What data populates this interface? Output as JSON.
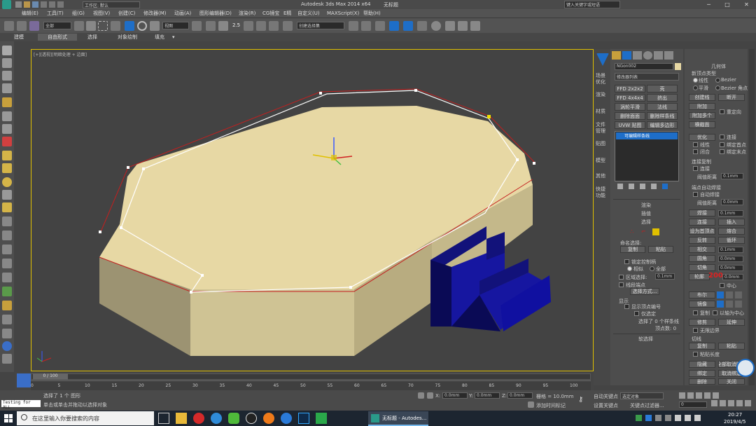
{
  "title_bar": {
    "workspace": "工作区: 默认",
    "app_title": "Autodesk 3ds Max  2014 x64",
    "file_name": "无标题",
    "search_placeholder": "键入关键字或短语"
  },
  "menu": [
    "编辑(E)",
    "工具(T)",
    "组(G)",
    "视图(V)",
    "创建(C)",
    "修改器(M)",
    "动画(A)",
    "图形编辑器(D)",
    "渲染(R)",
    "CG镜宝",
    "E精",
    "自定义(U)",
    "MAXScript(X)",
    "帮助(H)"
  ],
  "toolbar": {
    "filter": "全部",
    "coord": "视图",
    "snap_angle": "2.5",
    "selection_set": "创建选择集"
  },
  "ribbon_tabs": [
    "建模",
    "自由形式",
    "选择",
    "对象绘制",
    "填充"
  ],
  "viewport": {
    "label": "[+][透视][明暗处理 + 边面]"
  },
  "command_panel_left": [
    "场景优化",
    "渲染",
    "材质",
    "文件管理",
    "贴图",
    "模型",
    "其他",
    "快捷功能"
  ],
  "modifier_panel": {
    "object_name": "NGon002",
    "modifier_list": "修改器列表",
    "buttons": [
      "FFD 2x2x2",
      "壳",
      "FFD 4x4x4",
      "挤出",
      "涡轮平滑",
      "法线",
      "删除面面",
      "删除样条线",
      "UVW 贴图",
      "编辑多边形"
    ],
    "stack_item": "可编辑样条线",
    "rollouts": [
      "渲染",
      "插值",
      "选择"
    ],
    "named_selection": "命名选择:",
    "copy": "复制",
    "paste": "粘贴",
    "lock_handles": "锁定控制柄",
    "similar": "相似",
    "all": "全部",
    "area_selection": "区域选择:",
    "area_value": "0.1mm",
    "segment_end": "线段端点",
    "select_by": "选择方式...",
    "display": "显示",
    "show_vertex_numbers": "显示顶点编号",
    "selected_only": "仅选定",
    "selected_info": "选择了 0 个样条线",
    "vertex_count": "顶点数: 0",
    "soft_selection": "软选择"
  },
  "geometry_panel": {
    "title": "几何体",
    "new_vertex_type": "新顶点类型",
    "linear": "线性",
    "bezier": "Bezier",
    "smooth": "平滑",
    "bezier_corner": "Bezier 角点",
    "create_line": "创建线",
    "break": "断开",
    "attach": "附加",
    "attach_multiple": "附加多个",
    "reorient": "重定向",
    "cross_section": "横截面",
    "optimize": "优化",
    "connect": "连接",
    "linear2": "线性",
    "bind_first": "绑定首点",
    "closed": "闭合",
    "bind_last": "绑定末点",
    "connect_copy": "连接复制",
    "connect_chk": "连接",
    "threshold": "阈值距离",
    "threshold_value": "0.1mm",
    "end_point_auto_weld": "端点自动焊接",
    "auto_weld": "自动焊接",
    "threshold2": "阈值距离",
    "threshold2_value": "0.0mm",
    "weld": "焊接",
    "weld_value": "0.1mm",
    "connect_btn": "连接",
    "insert": "插入",
    "make_first": "设为首顶点",
    "fuse": "熔合",
    "reverse": "反转",
    "cycle": "循环",
    "crossinsert": "相交",
    "crossinsert_value": "0.1mm",
    "fillet": "圆角",
    "fillet_value": "0.0mm",
    "chamfer": "切角",
    "chamfer_value": "0.0mm",
    "outline": "轮廓",
    "outline_value": "200",
    "outline_unit": "0.0mm",
    "center": "中心",
    "boolean": "布尔",
    "mirror": "镜像",
    "copy_chk": "复制",
    "about_pivot": "以轴为中心",
    "trim": "修剪",
    "extend": "延伸",
    "infinite_bounds": "无限边界",
    "tangent": "切线",
    "copy_btn": "复制",
    "paste_btn": "粘贴",
    "paste_length": "粘贴长度",
    "hide": "隐藏",
    "unhide_all": "全部取消隐藏",
    "bind": "绑定",
    "unbind": "取消绑定",
    "delete": "删除",
    "close": "关闭"
  },
  "timeline": {
    "frame": "0 / 100",
    "ticks": [
      "0",
      "5",
      "10",
      "15",
      "20",
      "25",
      "30",
      "35",
      "40",
      "45",
      "50",
      "55",
      "60",
      "65",
      "70",
      "75",
      "80",
      "85",
      "90",
      "95",
      "100"
    ]
  },
  "status": {
    "maxscript_label": "Testing for ALL",
    "selected": "选择了 1 个 图形",
    "prompt": "单击或单击并拖动以选择对象",
    "x_label": "X:",
    "x_value": "0.0mm",
    "y_label": "Y:",
    "y_value": "0.0mm",
    "z_label": "Z:",
    "z_value": "0.0mm",
    "grid": "栅格 = 10.0mm",
    "add_time_tag": "添加时间标记",
    "auto_key": "自动关键点",
    "selected_objects": "选定对象",
    "set_key": "设置关键点",
    "key_filters": "关键点过滤器...",
    "frame_value": "0"
  },
  "taskbar": {
    "search_placeholder": "在这里输入你要搜索的内容",
    "active_app": "无标题 - Autodes...",
    "time": "20:27",
    "date": "2019/4/5"
  },
  "colors": {
    "accent": "#1e6ec8",
    "object_fill": "#e7d8a4",
    "stairs": "#12127a",
    "spline_red": "#c41f1f"
  }
}
